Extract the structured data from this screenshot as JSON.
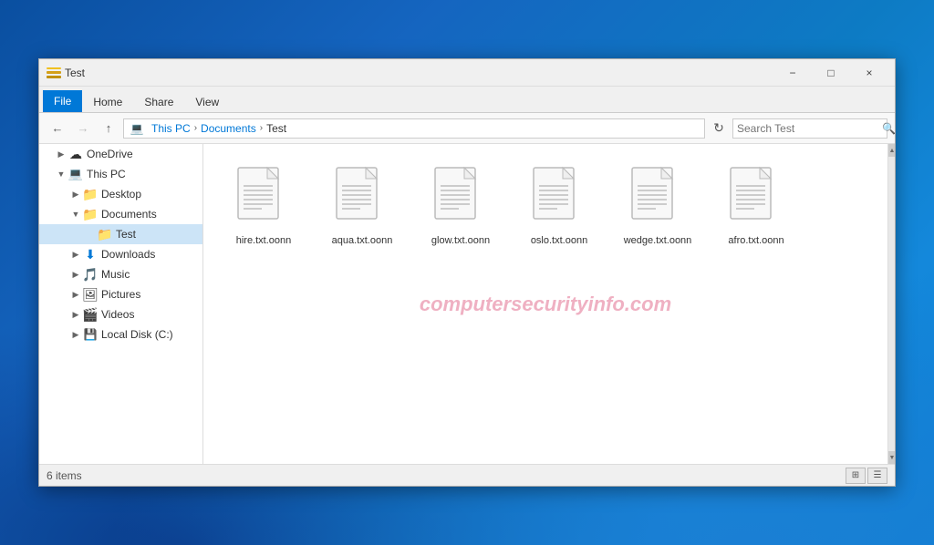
{
  "window": {
    "title": "Test",
    "icon": "folder-icon"
  },
  "titlebar": {
    "title": "Test",
    "minimize_label": "−",
    "maximize_label": "□",
    "close_label": "×"
  },
  "ribbon": {
    "tabs": [
      {
        "label": "File",
        "active": true
      },
      {
        "label": "Home",
        "active": false
      },
      {
        "label": "Share",
        "active": false
      },
      {
        "label": "View",
        "active": false
      }
    ]
  },
  "addressbar": {
    "back_btn": "←",
    "forward_btn": "→",
    "up_btn": "↑",
    "breadcrumb": [
      {
        "label": "This PC",
        "current": false
      },
      {
        "label": "Documents",
        "current": false
      },
      {
        "label": "Test",
        "current": true
      }
    ],
    "search_placeholder": "Search Test",
    "search_label": "Search Test"
  },
  "sidebar": {
    "items": [
      {
        "label": "OneDrive",
        "icon": "☁",
        "indent": 1,
        "expanded": false,
        "selected": false
      },
      {
        "label": "This PC",
        "icon": "💻",
        "indent": 1,
        "expanded": true,
        "selected": false
      },
      {
        "label": "Desktop",
        "icon": "📁",
        "indent": 2,
        "expanded": false,
        "selected": false
      },
      {
        "label": "Documents",
        "icon": "📁",
        "indent": 2,
        "expanded": true,
        "selected": false
      },
      {
        "label": "Test",
        "icon": "📁",
        "indent": 3,
        "expanded": false,
        "selected": true
      },
      {
        "label": "Downloads",
        "icon": "📥",
        "indent": 2,
        "expanded": false,
        "selected": false
      },
      {
        "label": "Music",
        "icon": "🎵",
        "indent": 2,
        "expanded": false,
        "selected": false
      },
      {
        "label": "Pictures",
        "icon": "🖼",
        "indent": 2,
        "expanded": false,
        "selected": false
      },
      {
        "label": "Videos",
        "icon": "🎬",
        "indent": 2,
        "expanded": false,
        "selected": false
      },
      {
        "label": "Local Disk (C:)",
        "icon": "💾",
        "indent": 2,
        "expanded": false,
        "selected": false
      }
    ]
  },
  "files": [
    {
      "name": "hire.txt.oonn"
    },
    {
      "name": "aqua.txt.oonn"
    },
    {
      "name": "glow.txt.oonn"
    },
    {
      "name": "oslo.txt.oonn"
    },
    {
      "name": "wedge.txt.oonn"
    },
    {
      "name": "afro.txt.oonn"
    }
  ],
  "statusbar": {
    "item_count": "6 items"
  },
  "watermark": {
    "text": "computersecurityinfo.com"
  }
}
